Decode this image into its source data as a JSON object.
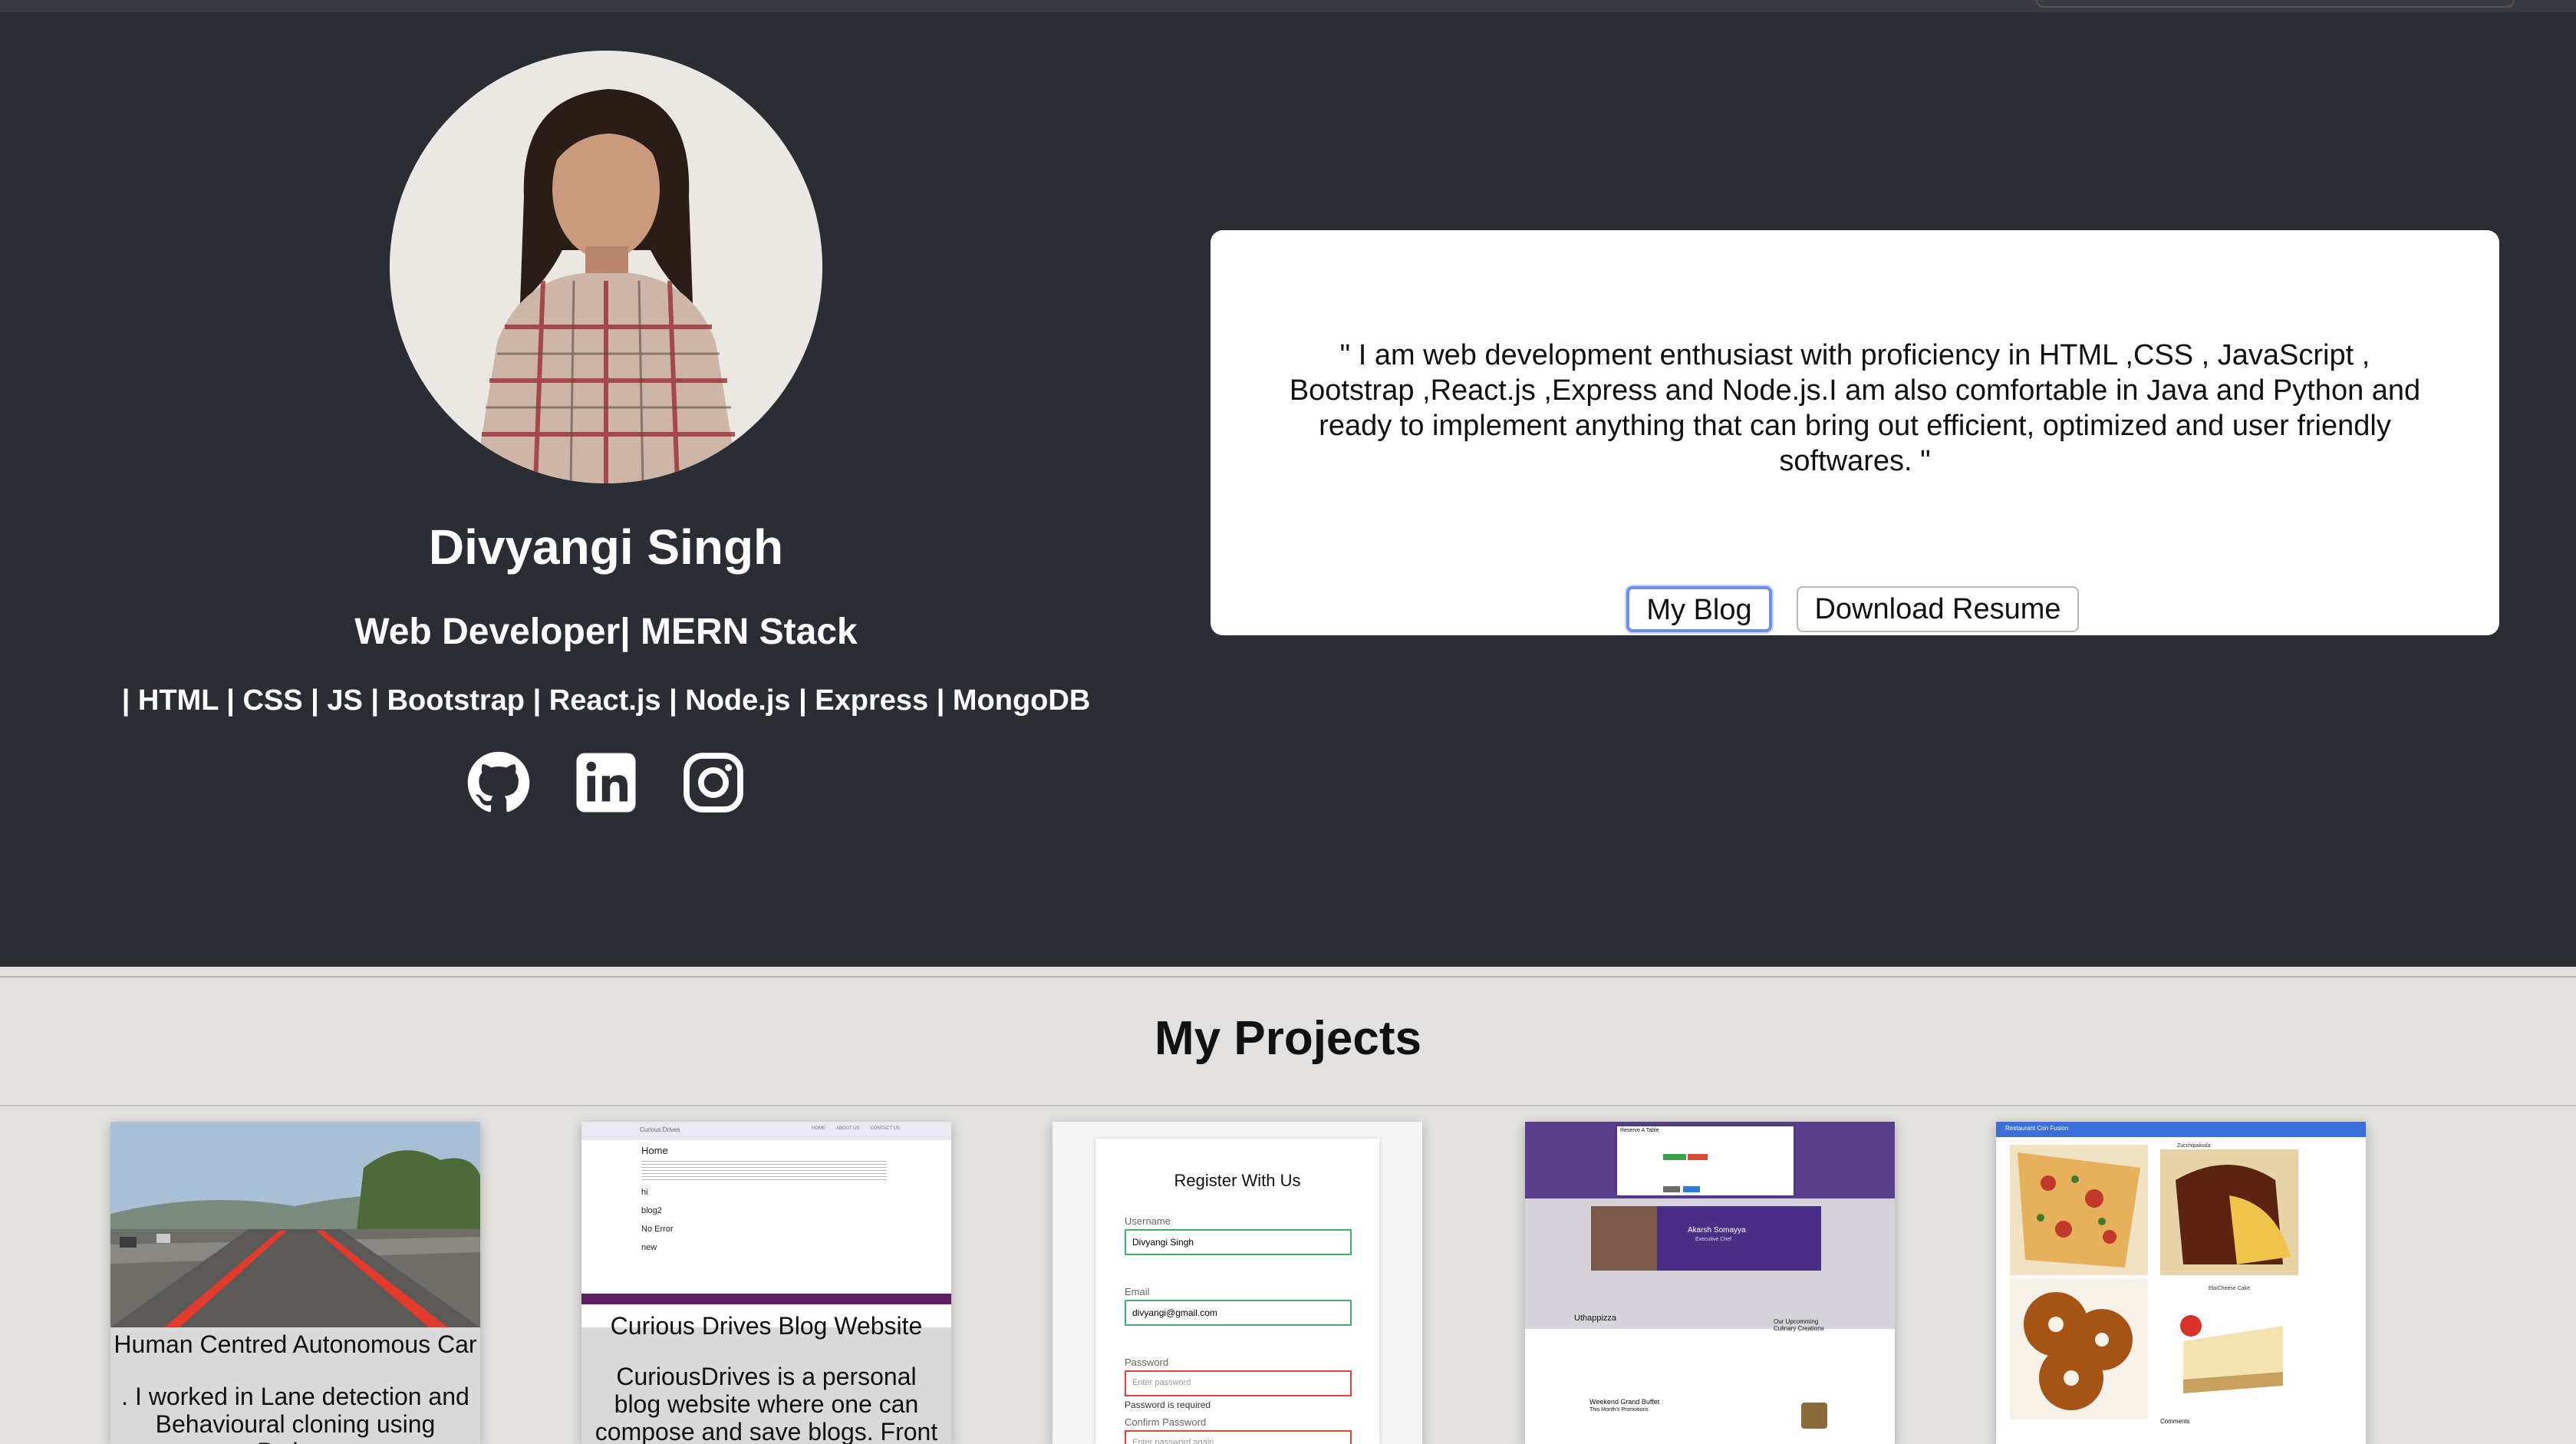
{
  "profile": {
    "name": "Divyangi Singh",
    "role": "Web Developer| MERN Stack",
    "skills": "| HTML | CSS | JS | Bootstrap | React.js | Node.js | Express | MongoDB",
    "social_icons": [
      "github-icon",
      "linkedin-icon",
      "instagram-icon"
    ]
  },
  "about": {
    "quote": "\" I am web development enthusiast with proficiency in HTML ,CSS , JavaScript , Bootstrap ,React.js ,Express and Node.js.I am also comfortable in Java and Python and ready to implement anything that can bring out efficient, optimized and user friendly softwares. \"",
    "buttons": {
      "blog": "My Blog",
      "resume": "Download Resume"
    }
  },
  "projects": {
    "title": "My Projects",
    "items": [
      {
        "title": "Human Centred Autonomous Car",
        "desc": ". I worked in Lane detection and Behavioural cloning using Python"
      },
      {
        "title": "Curious Drives Blog Website",
        "desc": "CuriousDrives is a personal blog website where one can compose and save blogs. Front end: HTML",
        "thumb": {
          "brand": "Curious Drives",
          "nav": [
            "HOME",
            "ABOUT US",
            "CONTACT US"
          ],
          "posts": [
            "Home",
            "hi",
            "blog2",
            "No Error",
            "new"
          ]
        }
      },
      {
        "title": "",
        "desc": "",
        "thumb": {
          "heading": "Register With Us",
          "fields": [
            {
              "label": "Username",
              "value": "Divyangi Singh",
              "status": "ok"
            },
            {
              "label": "Email",
              "value": "divyangi@gmail.com",
              "status": "ok"
            },
            {
              "label": "Password",
              "placeholder": "Enter password",
              "error": "Password is required",
              "status": "error"
            },
            {
              "label": "Confirm Password",
              "placeholder": "Enter password again",
              "status": "error"
            }
          ]
        }
      },
      {
        "title": "",
        "desc": "",
        "thumb": {
          "modal_title": "Reserve A Table",
          "chef": "Akarsh Somayya",
          "chef_role": "Executive Chef",
          "promo1": "Uthappizza",
          "promo2": "Weekend Grand Buffet",
          "promo3": "This Month's Promotions",
          "promo4": "Our Upcomming Culinary Creations"
        }
      },
      {
        "title": "",
        "desc": "",
        "thumb": {
          "header": "Restaurant Con Fusion",
          "dish1": "Zucchipakoda",
          "dish2": "ElaiCheese Cake",
          "comments": "Comments"
        }
      }
    ]
  },
  "colors": {
    "hero_bg": "#2b2d35",
    "page_bg": "#e2e1df",
    "card_bg": "#ffffff",
    "blog_button_border": "#6d8fe6"
  }
}
